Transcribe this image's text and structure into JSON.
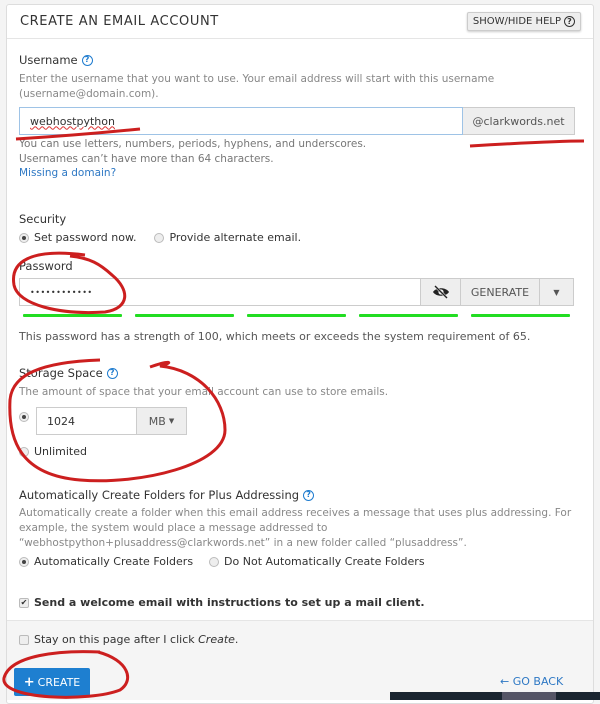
{
  "header": {
    "title": "CREATE AN EMAIL ACCOUNT",
    "help_button": "SHOW/HIDE HELP"
  },
  "username": {
    "label": "Username",
    "description": "Enter the username that you want to use. Your email address will start with this username (username@domain.com).",
    "value": "webhostpython",
    "domain": "@clarkwords.net",
    "hint_1": "You can use letters, numbers, periods, hyphens, and underscores.",
    "hint_2": "Usernames can’t have more than 64 characters.",
    "missing_domain_link": "Missing a domain?"
  },
  "security": {
    "label": "Security",
    "options": [
      {
        "label": "Set password now.",
        "selected": true
      },
      {
        "label": "Provide alternate email.",
        "selected": false
      }
    ]
  },
  "password": {
    "label": "Password",
    "value": "••••••••••••",
    "generate_label": "GENERATE",
    "strength_segments_filled": 5,
    "strength_segments_total": 5,
    "strength_color": "#22dd22",
    "strength_message": "This password has a strength of 100, which meets or exceeds the system requirement of 65."
  },
  "storage": {
    "label": "Storage Space",
    "description": "The amount of space that your email account can use to store emails.",
    "quota_value": "1024",
    "unit": "MB",
    "quota_selected": true,
    "unlimited_label": "Unlimited",
    "unlimited_selected": false
  },
  "plus_addressing": {
    "label": "Automatically Create Folders for Plus Addressing",
    "description": "Automatically create a folder when this email address receives a message that uses plus addressing. For example, the system would place a message addressed to “webhostpython+plusaddress@clarkwords.net” in a new folder called “plusaddress”.",
    "options": [
      {
        "label": "Automatically Create Folders",
        "selected": true
      },
      {
        "label": "Do Not Automatically Create Folders",
        "selected": false
      }
    ]
  },
  "welcome_email": {
    "label": "Send a welcome email with instructions to set up a mail client.",
    "checked": true
  },
  "footer": {
    "stay_label_prefix": "Stay on this page after I click ",
    "stay_label_em": "Create",
    "stay_label_suffix": ".",
    "stay_checked": false,
    "create_label": "CREATE",
    "go_back_label": "GO BACK"
  },
  "colors": {
    "accent": "#1e7fd0",
    "link": "#2e78c4",
    "annotation": "#cc1f1f"
  }
}
